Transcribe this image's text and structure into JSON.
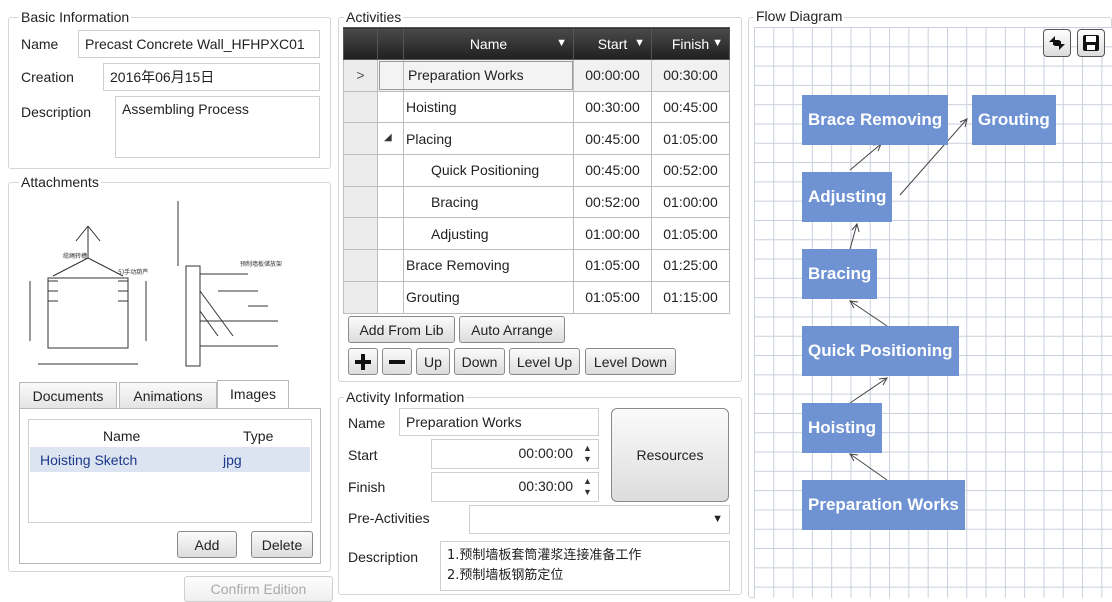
{
  "basic_info": {
    "title": "Basic Information",
    "name_label": "Name",
    "name_value": "Precast Concrete Wall_HFHPXC01",
    "creation_label": "Creation",
    "creation_value": "2016年06月15日",
    "description_label": "Description",
    "description_value": "Assembling Process"
  },
  "attachments": {
    "title": "Attachments",
    "sketch_icon": "hoisting-sketch-drawing",
    "tabs": [
      "Documents",
      "Animations",
      "Images"
    ],
    "active_tab": "Images",
    "list_headers": {
      "name": "Name",
      "type": "Type"
    },
    "items": [
      {
        "name": "Hoisting Sketch",
        "type": "jpg"
      }
    ],
    "add_label": "Add",
    "delete_label": "Delete"
  },
  "confirm_label": "Confirm Edition",
  "activities": {
    "title": "Activities",
    "columns": [
      "Name",
      "Start",
      "Finish"
    ],
    "filter_icon": "filter-icon",
    "rows": [
      {
        "marker": ">",
        "name": "Preparation Works",
        "start": "00:00:00",
        "finish": "00:30:00"
      },
      {
        "marker": "",
        "name": "Hoisting",
        "start": "00:30:00",
        "finish": "00:45:00"
      },
      {
        "marker": "",
        "name": "Placing",
        "start": "00:45:00",
        "finish": "01:05:00",
        "expander": "◢"
      },
      {
        "marker": "",
        "name": "Quick Positioning",
        "start": "00:45:00",
        "finish": "00:52:00"
      },
      {
        "marker": "",
        "name": "Bracing",
        "start": "00:52:00",
        "finish": "01:00:00"
      },
      {
        "marker": "",
        "name": "Adjusting",
        "start": "01:00:00",
        "finish": "01:05:00"
      },
      {
        "marker": "",
        "name": "Brace Removing",
        "start": "01:05:00",
        "finish": "01:25:00"
      },
      {
        "marker": "",
        "name": "Grouting",
        "start": "01:05:00",
        "finish": "01:15:00"
      }
    ],
    "add_from_lib_label": "Add From Lib",
    "auto_arrange_label": "Auto Arrange",
    "up_label": "Up",
    "down_label": "Down",
    "level_up_label": "Level Up",
    "level_down_label": "Level Down"
  },
  "activity_info": {
    "title": "Activity Information",
    "name_label": "Name",
    "name_value": "Preparation Works",
    "start_label": "Start",
    "start_value": "00:00:00",
    "finish_label": "Finish",
    "finish_value": "00:30:00",
    "pre_label": "Pre-Activities",
    "pre_value": "",
    "description_label": "Description",
    "description_lines": [
      "1.预制墙板套筒灌浆连接准备工作",
      "2.预制墙板钢筋定位"
    ],
    "resources_label": "Resources"
  },
  "flow": {
    "title": "Flow Diagram",
    "nodes": [
      "Brace Removing",
      "Grouting",
      "Adjusting",
      "Bracing",
      "Quick Positioning",
      "Hoisting",
      "Preparation Works"
    ],
    "node_color": "#6f93d2"
  }
}
